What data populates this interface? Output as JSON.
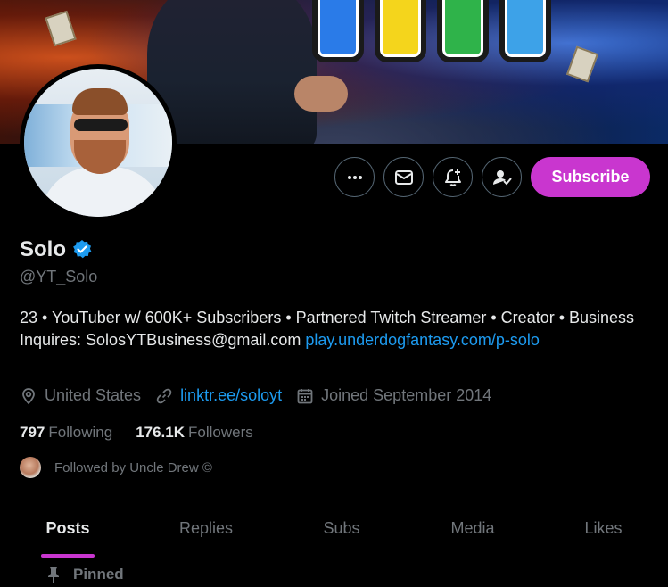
{
  "profile": {
    "display_name": "Solo",
    "handle": "@YT_Solo",
    "bio_text": "23 • YouTuber w/ 600K+ Subscribers • Partnered Twitch Streamer • Creator • Business Inquires: SolosYTBusiness@gmail.com ",
    "bio_link": "play.underdogfantasy.com/p-solo",
    "location": "United States",
    "website": "linktr.ee/soloyt",
    "joined": "Joined September 2014",
    "following_count": "797",
    "following_label": "Following",
    "followers_count": "176.1K",
    "followers_label": "Followers",
    "followed_by": "Followed by Uncle Drew ©"
  },
  "actions": {
    "subscribe_label": "Subscribe",
    "icons": [
      "more-icon",
      "message-icon",
      "notification-icon",
      "following-icon"
    ]
  },
  "tabs": [
    {
      "label": "Posts",
      "active": true
    },
    {
      "label": "Replies",
      "active": false
    },
    {
      "label": "Subs",
      "active": false
    },
    {
      "label": "Media",
      "active": false
    },
    {
      "label": "Likes",
      "active": false
    }
  ],
  "pinned_label": "Pinned",
  "colors": {
    "background": "#000000",
    "accent": "#c936cf",
    "link": "#1d9bf0",
    "muted": "#71767b",
    "text": "#e7e9ea",
    "verified": "#1d9bf0"
  }
}
